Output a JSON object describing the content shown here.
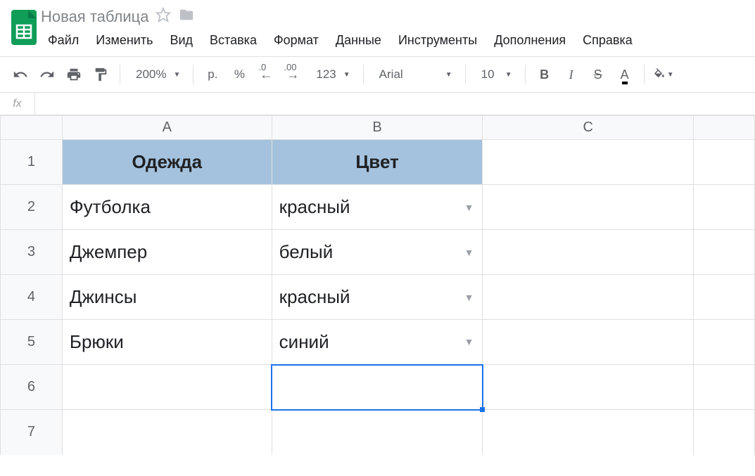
{
  "doc_title": "Новая таблица",
  "menu": [
    "Файл",
    "Изменить",
    "Вид",
    "Вставка",
    "Формат",
    "Данные",
    "Инструменты",
    "Дополнения",
    "Справка"
  ],
  "toolbar": {
    "zoom": "200%",
    "currency": "р.",
    "percent": "%",
    "dec_dec": ".0",
    "dec_inc": ".00",
    "num_format": "123",
    "font": "Arial",
    "font_size": "10",
    "bold": "B",
    "italic": "I",
    "strike": "S",
    "textcolor": "A"
  },
  "formula_bar": {
    "label": "fx",
    "value": ""
  },
  "columns": [
    "A",
    "B",
    "C"
  ],
  "row_nums": [
    "1",
    "2",
    "3",
    "4",
    "5",
    "6",
    "7"
  ],
  "sheet": {
    "header": {
      "a": "Одежда",
      "b": "Цвет"
    },
    "rows": [
      {
        "a": "Футболка",
        "b": "красный"
      },
      {
        "a": "Джемпер",
        "b": "белый"
      },
      {
        "a": "Джинсы",
        "b": "красный"
      },
      {
        "a": "Брюки",
        "b": "синий"
      }
    ]
  }
}
